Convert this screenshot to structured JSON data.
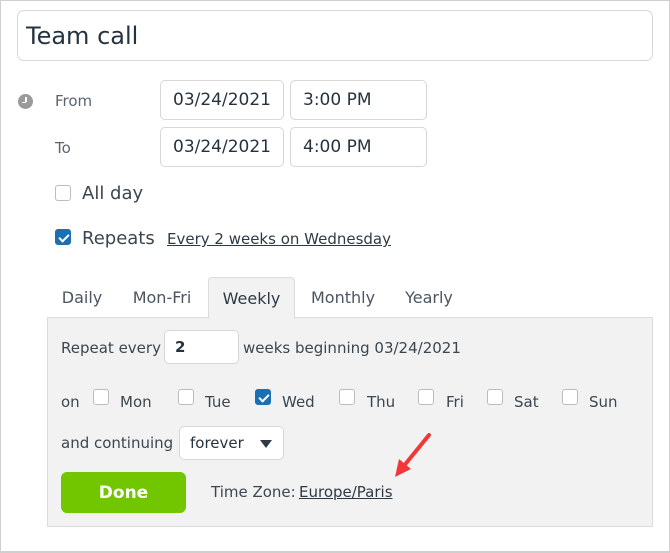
{
  "event": {
    "title": "Team call"
  },
  "schedule": {
    "from_label": "From",
    "to_label": "To",
    "from_date": "03/24/2021",
    "from_time": "3:00 PM",
    "to_date": "03/24/2021",
    "to_time": "4:00 PM",
    "clock_icon": "clock-icon"
  },
  "options": {
    "all_day": {
      "label": "All day",
      "checked": false
    },
    "repeats": {
      "label": "Repeats",
      "checked": true,
      "summary_link": "Every 2 weeks on Wednesday"
    }
  },
  "recurrence": {
    "tabs": [
      {
        "label": "Daily",
        "active": false
      },
      {
        "label": "Mon-Fri",
        "active": false
      },
      {
        "label": "Weekly",
        "active": true
      },
      {
        "label": "Monthly",
        "active": false
      },
      {
        "label": "Yearly",
        "active": false
      }
    ],
    "repeat_every_label": "Repeat every",
    "repeat_every_value": "2",
    "weeks_beginning_text": "weeks beginning 03/24/2021",
    "on_label": "on",
    "days": [
      {
        "label": "Mon",
        "checked": false
      },
      {
        "label": "Tue",
        "checked": false
      },
      {
        "label": "Wed",
        "checked": true
      },
      {
        "label": "Thu",
        "checked": false
      },
      {
        "label": "Fri",
        "checked": false
      },
      {
        "label": "Sat",
        "checked": false
      },
      {
        "label": "Sun",
        "checked": false
      }
    ],
    "continuing_label": "and continuing",
    "continuing_value": "forever",
    "done_label": "Done",
    "timezone_label": "Time Zone:",
    "timezone_value": "Europe/Paris"
  },
  "annotation": {
    "arrow_color": "#f0383a"
  },
  "colors": {
    "accent_blue": "#1b6fb3",
    "done_green": "#72c600"
  }
}
